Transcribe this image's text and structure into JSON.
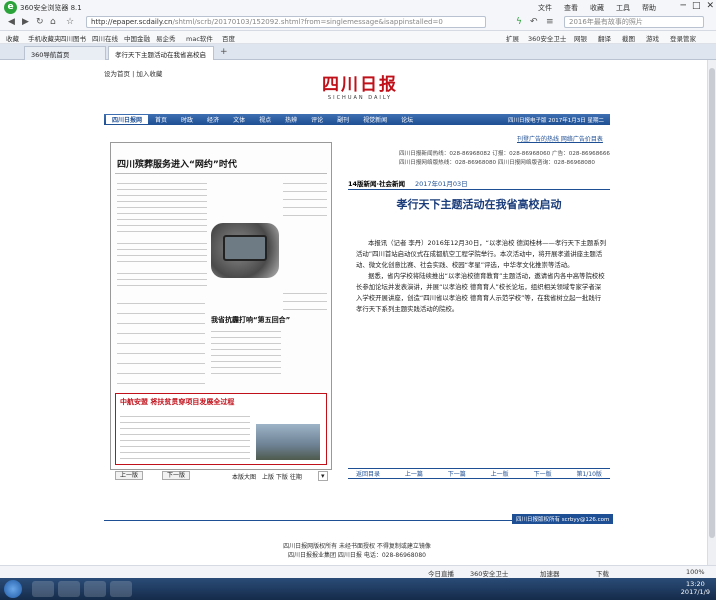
{
  "browser": {
    "title": "360安全浏览器 8.1",
    "menu": [
      "文件",
      "查看",
      "收藏",
      "工具",
      "帮助"
    ],
    "url_host": "http://epaper.scdaily.cn",
    "url_path": "/shtml/scrb/20170103/152092.shtml?from=singlemessage&isappinstalled=0",
    "search_placeholder": "2016年最有故事的照片",
    "bookmarks": [
      "收藏",
      "手机收藏夹",
      "四川图书",
      "四川在线",
      "中国金融",
      "易企秀",
      "mac软件",
      "百度"
    ],
    "bookmarks_right": [
      "扩展",
      "360安全卫士",
      "网银",
      "翻译",
      "截图",
      "游戏",
      "登录管家"
    ],
    "tabs": [
      {
        "label": "360导航首页",
        "active": false
      },
      {
        "label": "孝行天下主题活动在我省高校启",
        "active": true
      }
    ]
  },
  "page": {
    "top_links": "设为首页  |  加入收藏",
    "logo_text": "四川日报",
    "logo_sub": "SICHUAN DAILY",
    "nav_items": [
      "四川日报网",
      "首页",
      "时政",
      "经济",
      "文体",
      "视点",
      "热辨",
      "评论",
      "副刊",
      "视觉新闻",
      "论坛"
    ],
    "nav_date": "四川日报电子版 2017年1月3日 星期二",
    "ad_link": "刊登广告的热线 网络广告价目表",
    "contacts": [
      "四川日报新闻热线：028-86968082  订报：028-86968060  广告：028-86968666",
      "四川日报网络版热线：028-86968080  四川日报网络版咨询：028-86968080"
    ],
    "section": "14版新闻·社会新闻",
    "section_date": "2017年01月03日",
    "headline": "孝行天下主题活动在我省高校启动",
    "article": [
      "本报讯（记者 李丹）2016年12月30日，“以孝治校 德润桂林——孝行天下主题系列活动”四川首站启动仪式在成都航空工程学院举行。本次活动中，将开展孝道讲座主题活动、微文化创意比赛、社会实践、校园“孝星”评选，中华孝文化推崇等活动。",
      "据悉，省内学校将陆续推出“以孝治校德育教育”主题活动，邀请省内各中高等院校校长参加论坛并发表演讲，并展“以孝治校 德育育人”校长论坛，组织相关领域专家学者深入学校开展讲座，创造“四川省以孝治校 德育育人示范学校”等，在我省树立起一批践行孝行天下系列主题实践活动的院校。"
    ],
    "newspaper": {
      "head1": "四川殡葬服务进入“网约”时代",
      "head2": "我省抗霾打响“第五回合”",
      "head3": "中航安盟 将扶贫贯穿项目发展全过程"
    },
    "pager": {
      "prev": "上一版",
      "next": "下一版",
      "view": "本版大图",
      "links": "上版 下版 往期"
    },
    "bottom_nav": [
      "返回目录",
      "上一篇",
      "下一篇",
      "上一版",
      "下一版",
      "第1/10版"
    ],
    "copyright_tag": "四川日报版权所有 scrbyy@126.com",
    "footer": [
      "四川日报网版权所有 未经书面授权 不得复制或建立镜像",
      "四川日报报业集团 四川日报 电话：028-86968080"
    ]
  },
  "statusbar": {
    "items": [
      "今日直播",
      "360安全卫士",
      "加速器",
      "下载",
      "100%"
    ]
  },
  "taskbar": {
    "time": "13:20",
    "date": "2017/1/9"
  },
  "colors": {
    "brand": "#c0101a",
    "nav": "#1e4e93",
    "accent": "#2aa33a"
  }
}
